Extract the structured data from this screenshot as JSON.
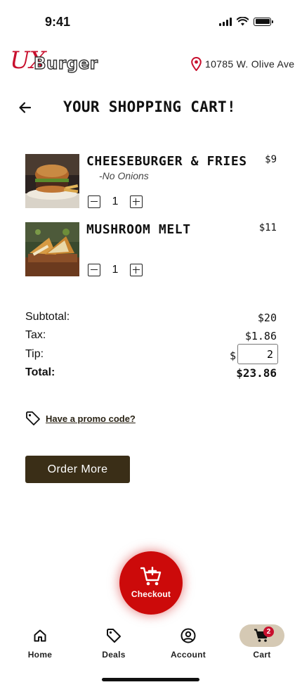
{
  "status_bar": {
    "time": "9:41",
    "icons": [
      "signal-icon",
      "wifi-icon",
      "battery-icon"
    ]
  },
  "header": {
    "logo": {
      "ux": "UX",
      "burger": "Burger"
    },
    "location": "10785 W. Olive Ave"
  },
  "page": {
    "title": "YOUR SHOPPING CART!"
  },
  "cart": {
    "items": [
      {
        "name": "CHEESEBURGER & FRIES",
        "note": "-No Onions",
        "price": "$9",
        "quantity": "1"
      },
      {
        "name": "MUSHROOM MELT",
        "note": "",
        "price": "$11",
        "quantity": "1"
      }
    ]
  },
  "summary": {
    "subtotal_label": "Subtotal:",
    "subtotal": "$20",
    "tax_label": "Tax:",
    "tax": "$1.86",
    "tip_label": "Tip:",
    "tip_currency": "$",
    "tip_value": "2",
    "total_label": "Total:",
    "total": "$23.86"
  },
  "promo": {
    "label": "Have a promo code?"
  },
  "actions": {
    "order_more": "Order More",
    "checkout": "Checkout"
  },
  "nav": {
    "items": [
      {
        "label": "Home",
        "icon": "home-icon",
        "active": false
      },
      {
        "label": "Deals",
        "icon": "tag-icon",
        "active": false
      },
      {
        "label": "Account",
        "icon": "account-icon",
        "active": false
      },
      {
        "label": "Cart",
        "icon": "cart-icon",
        "active": true,
        "badge": "2"
      }
    ]
  },
  "colors": {
    "brand_red": "#cc0a0a",
    "logo_red": "#c8102e",
    "button_brown": "#3a2e17",
    "active_pill": "#d5c9b4"
  }
}
